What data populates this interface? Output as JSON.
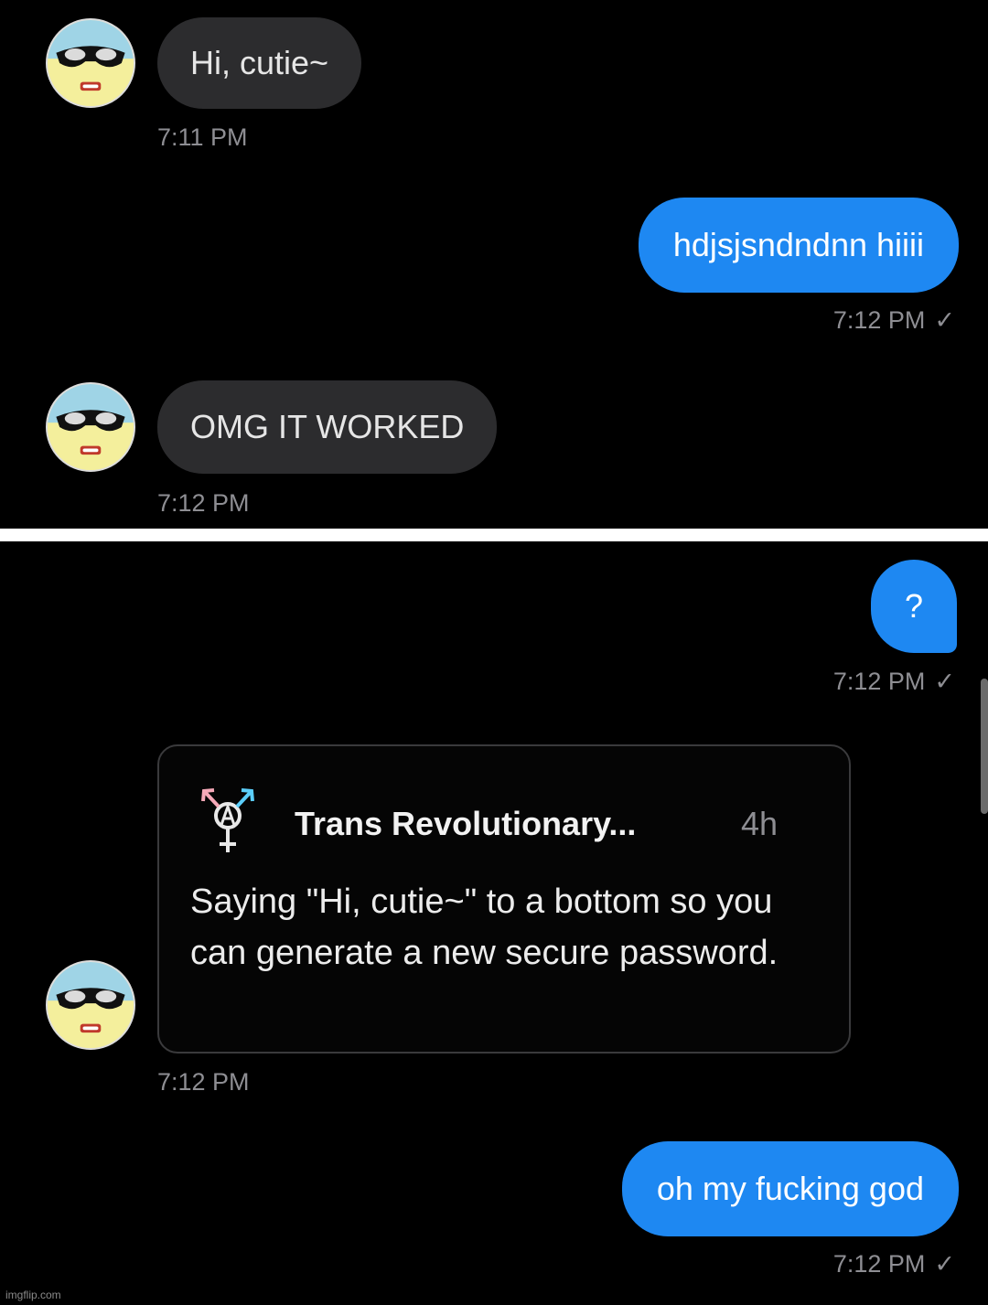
{
  "top_panel": {
    "msg1": {
      "text": "Hi, cutie~",
      "time": "7:11 PM"
    },
    "msg2": {
      "text": "hdjsjsndndnn hiiii",
      "time": "7:12 PM",
      "check": "✓"
    },
    "msg3": {
      "text": "OMG IT WORKED",
      "time": "7:12 PM"
    }
  },
  "bottom_panel": {
    "msg1": {
      "text": "?",
      "time": "7:12 PM",
      "check": "✓"
    },
    "shared_post": {
      "account": "Trans Revolutionary...",
      "age": "4h",
      "text": "Saying \"Hi, cutie~\" to a bottom so you can generate a new secure password.",
      "time": "7:12 PM",
      "icon": "trans-anarchy-symbol-icon"
    },
    "msg2": {
      "text": "oh my fucking god",
      "time": "7:12 PM",
      "check": "✓"
    }
  },
  "watermark": "imgflip.com",
  "colors": {
    "background": "#000000",
    "incoming_bubble": "#2c2c2e",
    "outgoing_bubble": "#1e88f2",
    "timestamp": "#8e8e93"
  }
}
